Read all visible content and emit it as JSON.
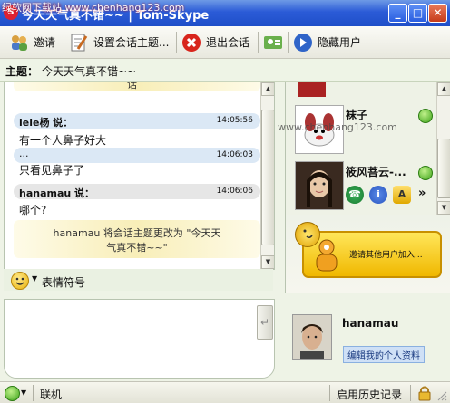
{
  "window": {
    "title": "今天天气真不错~~  |  Tom-Skype",
    "watermark_top": "绿软网下载站 www.chenhang123.com",
    "watermark_mid": "www.chenhang123.com"
  },
  "toolbar": {
    "invite": "邀请",
    "set_topic": "设置会话主题...",
    "leave": "退出会话",
    "hide_users": "隐藏用户"
  },
  "topic": {
    "label": "主题：",
    "value": "今天天气真不错~~"
  },
  "chat": {
    "partial_top": "话",
    "messages": [
      {
        "sender": "lele杨 说：",
        "time": "14:05:56",
        "lines": [
          "有一个人鼻子好大"
        ]
      },
      {
        "sender": "...",
        "time": "14:06:03",
        "lines": [
          "只看见鼻子了"
        ]
      },
      {
        "sender": "hanamau 说：",
        "time": "14:06:06",
        "lines": [
          "哪个?"
        ]
      }
    ],
    "notice_line1": "hanamau 将会话主题更改为 \"今天天",
    "notice_line2": "气真不错~~\""
  },
  "emoticon": {
    "label": "表情符号"
  },
  "users": [
    {
      "name": "袜子"
    },
    {
      "name": "筱风菩云-..."
    }
  ],
  "more": "»",
  "add_panel": {
    "text": "邀请其他用户加入..."
  },
  "me": {
    "name": "hanamau",
    "edit_profile": "编辑我的个人资料"
  },
  "status": {
    "state": "联机",
    "history": "启用历史记录"
  },
  "colors": {
    "online": "#3ea41a",
    "accent": "#2b5bd7",
    "notice": "#f8eeb8"
  }
}
